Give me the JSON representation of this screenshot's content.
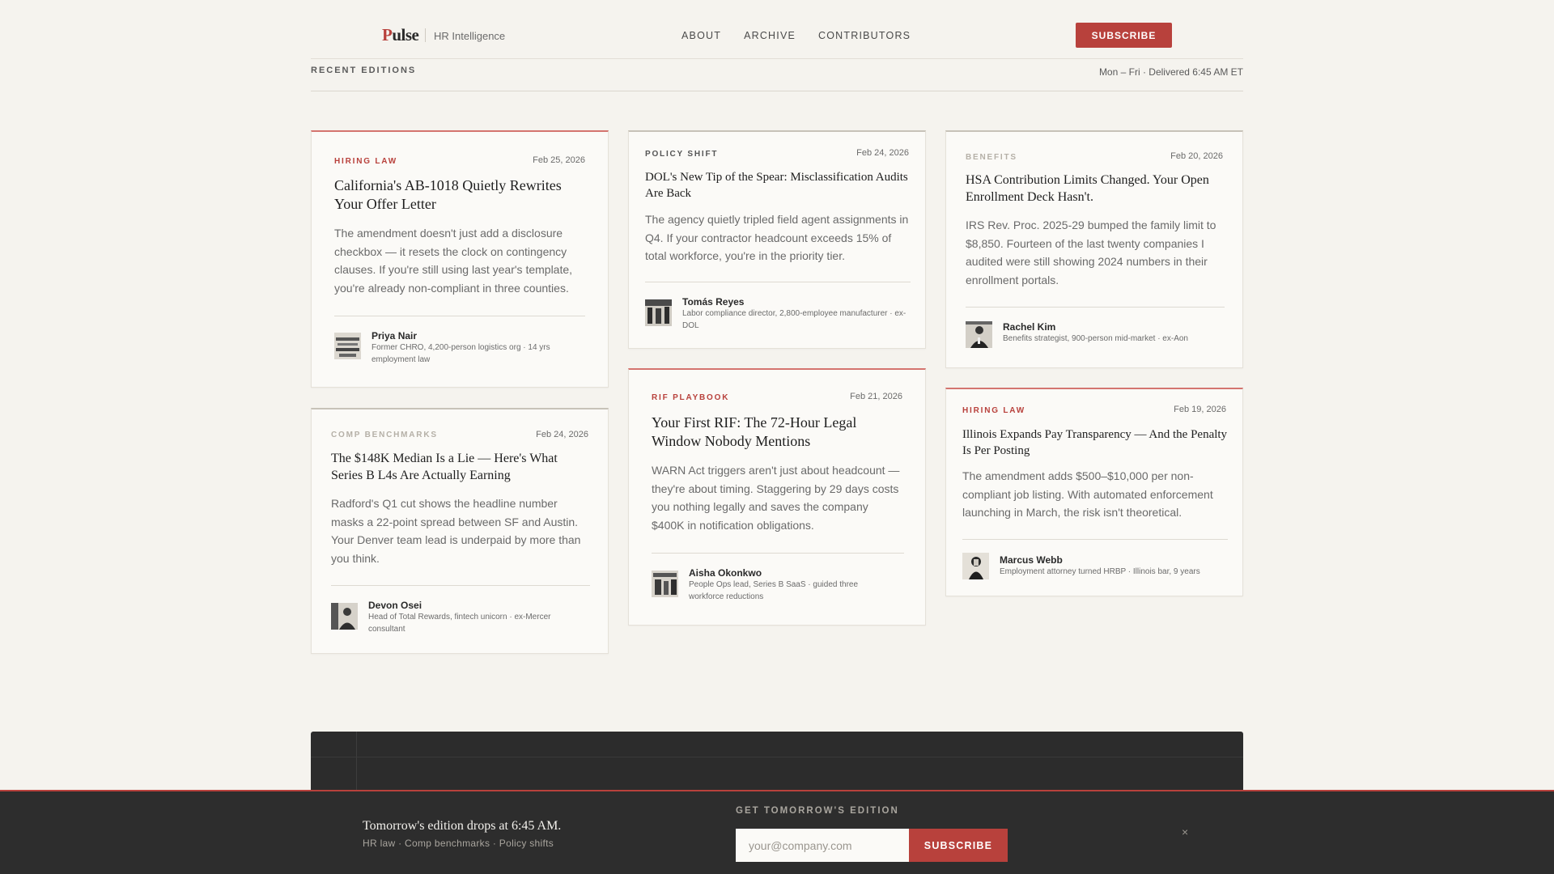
{
  "header": {
    "brand": "Pulse",
    "brand_sub": "HR Intelligence",
    "nav": [
      "ABOUT",
      "ARCHIVE",
      "CONTRIBUTORS"
    ],
    "subscribe_label": "SUBSCRIBE"
  },
  "section": {
    "label": "RECENT EDITIONS",
    "meta": "Mon – Fri · Delivered 6:45 AM ET"
  },
  "cards": [
    {
      "tag": "HIRING LAW",
      "date": "Feb 25, 2026",
      "title": "California's AB-1018 Quietly Rewrites Your Offer Letter",
      "body": "The amendment doesn't just add a disclosure checkbox — it resets the clock on contingency clauses. If you're still using last year's template, you're already non-compliant in three counties.",
      "author": "Priya Nair",
      "bio": "Former CHRO, 4,200-person logistics org · 14 yrs employment law"
    },
    {
      "tag": "COMP BENCHMARKS",
      "date": "Feb 24, 2026",
      "title": "The $148K Median Is a Lie — Here's What Series B L4s Are Actually Earning",
      "body": "Radford's Q1 cut shows the headline number masks a 22-point spread between SF and Austin. Your Denver team lead is underpaid by more than you think.",
      "author": "Devon Osei",
      "bio": "Head of Total Rewards, fintech unicorn · ex-Mercer consultant"
    },
    {
      "tag": "POLICY SHIFT",
      "date": "Feb 24, 2026",
      "title": "DOL's New Tip of the Spear: Misclassification Audits Are Back",
      "body": "The agency quietly tripled field agent assignments in Q4. If your contractor headcount exceeds 15% of total workforce, you're in the priority tier.",
      "author": "Tomás Reyes",
      "bio": "Labor compliance director, 2,800-employee manufacturer · ex-DOL"
    },
    {
      "tag": "RIF PLAYBOOK",
      "date": "Feb 21, 2026",
      "title": "Your First RIF: The 72-Hour Legal Window Nobody Mentions",
      "body": "WARN Act triggers aren't just about headcount — they're about timing. Staggering by 29 days costs you nothing legally and saves the company $400K in notification obligations.",
      "author": "Aisha Okonkwo",
      "bio": "People Ops lead, Series B SaaS · guided three workforce reductions"
    },
    {
      "tag": "BENEFITS",
      "date": "Feb 20, 2026",
      "title": "HSA Contribution Limits Changed. Your Open Enrollment Deck Hasn't.",
      "body": "IRS Rev. Proc. 2025-29 bumped the family limit to $8,850. Fourteen of the last twenty companies I audited were still showing 2024 numbers in their enrollment portals.",
      "author": "Rachel Kim",
      "bio": "Benefits strategist, 900-person mid-market · ex-Aon"
    },
    {
      "tag": "HIRING LAW",
      "date": "Feb 19, 2026",
      "title": "Illinois Expands Pay Transparency — And the Penalty Is Per Posting",
      "body": "The amendment adds $500–$10,000 per non-compliant job listing. With automated enforcement launching in March, the risk isn't theoretical.",
      "author": "Marcus Webb",
      "bio": "Employment attorney turned HRBP · Illinois bar, 9 years"
    }
  ],
  "sticky": {
    "title": "Tomorrow's edition drops at 6:45 AM.",
    "sub": "HR law · Comp benchmarks · Policy shifts",
    "label": "GET TOMORROW'S EDITION",
    "placeholder": "your@company.com",
    "button": "SUBSCRIBE",
    "close": "×"
  },
  "colors": {
    "accent": "#b8413c",
    "background": "#f5f3ee",
    "dark": "#2d2d2d"
  }
}
